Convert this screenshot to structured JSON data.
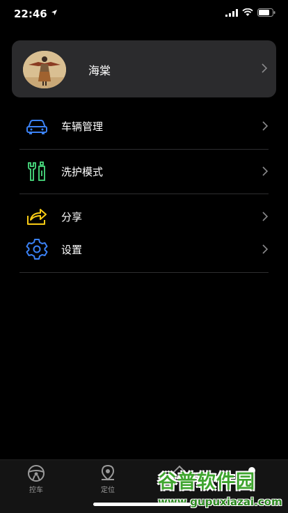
{
  "status_bar": {
    "time": "22:46"
  },
  "profile": {
    "name": "海棠"
  },
  "menu": {
    "items": [
      {
        "label": "车辆管理",
        "icon": "car-icon",
        "color": "#3b82f6"
      },
      {
        "label": "洗护模式",
        "icon": "wrench-icon",
        "color": "#4ade80"
      },
      {
        "label": "分享",
        "icon": "share-icon",
        "color": "#facc15"
      },
      {
        "label": "设置",
        "icon": "gear-icon",
        "color": "#3b82f6"
      }
    ]
  },
  "tabbar": {
    "tabs": [
      {
        "label": "控车",
        "icon": "steering-wheel-icon"
      },
      {
        "label": "定位",
        "icon": "location-pin-icon"
      }
    ]
  },
  "watermark": {
    "title": "谷普软件园",
    "url": "www.gupuxiazai.com"
  }
}
